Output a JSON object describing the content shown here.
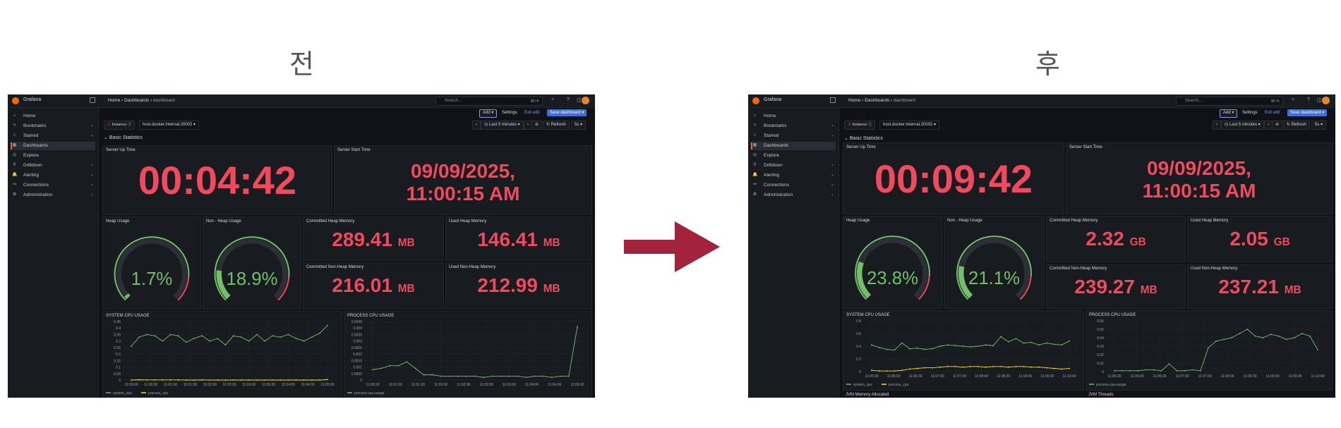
{
  "labels": {
    "before": "전",
    "after": "후"
  },
  "colors": {
    "accent": "#f2495c",
    "ok": "#73bf69",
    "series_yellow": "#fade2a",
    "arrow": "#a3233c",
    "primary": "#3d71d9"
  },
  "shots": [
    {
      "topbar": {
        "brand": "Grafana",
        "crumb_home": "Home",
        "crumb_dashboards": "Dashboards",
        "crumb_current": "dashboard",
        "search_placeholder": "Search...",
        "search_shortcut": "⌘+k"
      },
      "nav": [
        {
          "label": "Home",
          "icon": "home-icon"
        },
        {
          "label": "Bookmarks",
          "icon": "bookmark-icon"
        },
        {
          "label": "Starred",
          "icon": "star-icon"
        },
        {
          "label": "Dashboards",
          "icon": "dashboards-icon"
        },
        {
          "label": "Explore",
          "icon": "explore-icon"
        },
        {
          "label": "Drilldown",
          "icon": "drilldown-icon"
        },
        {
          "label": "Alerting",
          "icon": "alert-icon"
        },
        {
          "label": "Connections",
          "icon": "connections-icon"
        },
        {
          "label": "Administration",
          "icon": "gear-icon"
        }
      ],
      "actions": {
        "add": "Add",
        "settings": "Settings",
        "exit": "Exit edit",
        "save": "Save dashboard"
      },
      "variables": {
        "label": "Instance",
        "value": "host.docker.internal:20002"
      },
      "time": {
        "range": "Last 5 minutes",
        "refresh": "Refresh",
        "interval": "5s"
      },
      "row_title": "Basic Statistics",
      "panels": {
        "uptime": {
          "title": "Server Up Time",
          "value": "00:04:42"
        },
        "start": {
          "title": "Server Start Time",
          "line1": "09/09/2025,",
          "line2": "11:00:15 AM"
        },
        "heap_usage": {
          "title": "Heap Usage",
          "value": "1.7%",
          "fraction": 0.017
        },
        "nonheap_usage": {
          "title": "Non - Heap Usage",
          "value": "18.9%",
          "fraction": 0.189
        },
        "committed_heap": {
          "title": "Committed Heap Memory",
          "value": "289.41",
          "unit": "MB"
        },
        "used_heap": {
          "title": "Used Heap Memory",
          "value": "146.41",
          "unit": "MB"
        },
        "committed_nonheap": {
          "title": "Committed Non-Heap Memory",
          "value": "216.01",
          "unit": "MB"
        },
        "used_nonheap": {
          "title": "Used Non-Heap Memory",
          "value": "212.99",
          "unit": "MB"
        }
      },
      "extra_titles": [],
      "chart_data": [
        {
          "type": "line",
          "title": "SYSTEM CPU USAGE",
          "x": [
            "11:00:00",
            "11:00:30",
            "11:01:00",
            "11:01:30",
            "11:02:00",
            "11:02:30",
            "11:03:00",
            "11:03:30",
            "11:04:00",
            "11:04:30",
            "11:05:00"
          ],
          "yticks": [
            "0.45",
            "0.4",
            "0.35",
            "0.3",
            "0.25",
            "0.2",
            "0.15",
            "0.1",
            "0.05",
            "0"
          ],
          "ylim": [
            0,
            0.45
          ],
          "series": [
            {
              "name": "system_cpu",
              "color": "#73bf69",
              "values": [
                0.26,
                0.33,
                0.35,
                0.34,
                0.3,
                0.35,
                0.34,
                0.29,
                0.32,
                0.34,
                0.3,
                0.32,
                0.27,
                0.34,
                0.33,
                0.3,
                0.35,
                0.3,
                0.34,
                0.33,
                0.35,
                0.32,
                0.3,
                0.33,
                0.36,
                0.42
              ]
            },
            {
              "name": "process_cpu",
              "color": "#fade2a",
              "values": [
                0,
                0.002,
                0.001,
                0.001,
                0.001,
                0.001,
                0.001,
                0,
                0,
                0.001,
                0,
                0,
                0,
                0,
                0,
                0,
                0,
                0,
                0,
                0,
                0,
                0,
                0,
                0,
                0,
                0.004
              ]
            }
          ]
        },
        {
          "type": "line",
          "title": "PROCESS CPU USAGE",
          "x": [
            "11:00:30",
            "11:01:00",
            "11:01:30",
            "11:02:00",
            "11:02:30",
            "11:03:00",
            "11:03:30",
            "11:04:00",
            "11:04:30",
            "11:05:00"
          ],
          "yticks": [
            "0.0045",
            "0.004",
            "0.0035",
            "0.003",
            "0.0025",
            "0.002",
            "0.0015",
            "0.001",
            "0.0005",
            "0"
          ],
          "ylim": [
            0,
            0.0045
          ],
          "series": [
            {
              "name": "process-cpu-usage",
              "color": "#73bf69",
              "values": [
                0.0008,
                0.0009,
                0.0011,
                0.0011,
                0.0014,
                0.0009,
                0.0004,
                0.0004,
                0.0003,
                0.0003,
                0.0003,
                0.0003,
                0.0003,
                0.0002,
                0.0003,
                0.0003,
                0.0003,
                0.0003,
                0.0002,
                0.0003,
                0.0003,
                0.0002,
                0.0003,
                0.0003,
                0.0041
              ]
            }
          ]
        }
      ]
    },
    {
      "topbar": {
        "brand": "Grafana",
        "crumb_home": "Home",
        "crumb_dashboards": "Dashboards",
        "crumb_current": "dashboard",
        "search_placeholder": "Search...",
        "search_shortcut": "⌘+k"
      },
      "nav": [
        {
          "label": "Home",
          "icon": "home-icon"
        },
        {
          "label": "Bookmarks",
          "icon": "bookmark-icon"
        },
        {
          "label": "Starred",
          "icon": "star-icon"
        },
        {
          "label": "Dashboards",
          "icon": "dashboards-icon"
        },
        {
          "label": "Explore",
          "icon": "explore-icon"
        },
        {
          "label": "Drilldown",
          "icon": "drilldown-icon"
        },
        {
          "label": "Alerting",
          "icon": "alert-icon"
        },
        {
          "label": "Connections",
          "icon": "connections-icon"
        },
        {
          "label": "Administration",
          "icon": "gear-icon"
        }
      ],
      "actions": {
        "add": "Add",
        "settings": "Settings",
        "exit": "Exit edit",
        "save": "Save dashboard"
      },
      "variables": {
        "label": "Instance",
        "value": "host.docker.internal:20002"
      },
      "time": {
        "range": "Last 5 minutes",
        "refresh": "Refresh",
        "interval": "5s"
      },
      "row_title": "Basic Statistics",
      "panels": {
        "uptime": {
          "title": "Server Up Time",
          "value": "00:09:42"
        },
        "start": {
          "title": "Server Start Time",
          "line1": "09/09/2025,",
          "line2": "11:00:15 AM"
        },
        "heap_usage": {
          "title": "Heap Usage",
          "value": "23.8%",
          "fraction": 0.238
        },
        "nonheap_usage": {
          "title": "Non - Heap Usage",
          "value": "21.1%",
          "fraction": 0.211
        },
        "committed_heap": {
          "title": "Committed Heap Memory",
          "value": "2.32",
          "unit": "GB"
        },
        "used_heap": {
          "title": "Used Heap Memory",
          "value": "2.05",
          "unit": "GB"
        },
        "committed_nonheap": {
          "title": "Committed Non-Heap Memory",
          "value": "239.27",
          "unit": "MB"
        },
        "used_nonheap": {
          "title": "Used Non-Heap Memory",
          "value": "237.21",
          "unit": "MB"
        }
      },
      "extra_titles": [
        "JVM Memory Allocated",
        "JVM Threads"
      ],
      "chart_data": [
        {
          "type": "line",
          "title": "SYSTEM CPU USAGE",
          "x": [
            "11:05:30",
            "11:06:00",
            "11:06:30",
            "11:07:00",
            "11:07:30",
            "11:08:00",
            "11:08:30",
            "11:09:00",
            "11:09:30",
            "11:10:00"
          ],
          "yticks": [
            "0.8",
            "0.6",
            "0.4",
            "0.2",
            "0"
          ],
          "ylim": [
            0,
            0.8
          ],
          "series": [
            {
              "name": "system_cpu",
              "color": "#73bf69",
              "values": [
                0.42,
                0.38,
                0.35,
                0.34,
                0.45,
                0.36,
                0.37,
                0.35,
                0.36,
                0.4,
                0.42,
                0.41,
                0.4,
                0.39,
                0.4,
                0.42,
                0.41,
                0.55,
                0.47,
                0.52,
                0.45,
                0.46,
                0.42,
                0.45,
                0.43,
                0.42,
                0.48
              ]
            },
            {
              "name": "process_cpu",
              "color": "#fade2a",
              "values": [
                0.02,
                0.01,
                0.01,
                0.01,
                0.02,
                0.04,
                0.05,
                0.06,
                0.06,
                0.07,
                0.08,
                0.08,
                0.07,
                0.08,
                0.08,
                0.07,
                0.08,
                0.08,
                0.07,
                0.08,
                0.08,
                0.07,
                0.07,
                0.06,
                0.05,
                0.04,
                0.05
              ]
            }
          ]
        },
        {
          "type": "line",
          "title": "PROCESS CPU USAGE",
          "x": [
            "11:05:30",
            "11:06:00",
            "11:06:30",
            "11:07:00",
            "11:07:30",
            "11:08:00",
            "11:08:30",
            "11:09:00",
            "11:09:30",
            "11:10:00"
          ],
          "yticks": [
            "0.06",
            "0.05",
            "0.04",
            "0.03",
            "0.02",
            "0.01",
            "0"
          ],
          "ylim": [
            0,
            0.06
          ],
          "series": [
            {
              "name": "process-cpu-usage",
              "color": "#73bf69",
              "values": [
                0.001,
                0.001,
                0.001,
                0.001,
                0.002,
                0.002,
                0.001,
                0.009,
                0.001,
                0.001,
                0.002,
                0.001,
                0.028,
                0.036,
                0.038,
                0.04,
                0.045,
                0.05,
                0.042,
                0.04,
                0.044,
                0.042,
                0.038,
                0.04,
                0.045,
                0.042,
                0.026
              ]
            }
          ]
        }
      ]
    }
  ]
}
